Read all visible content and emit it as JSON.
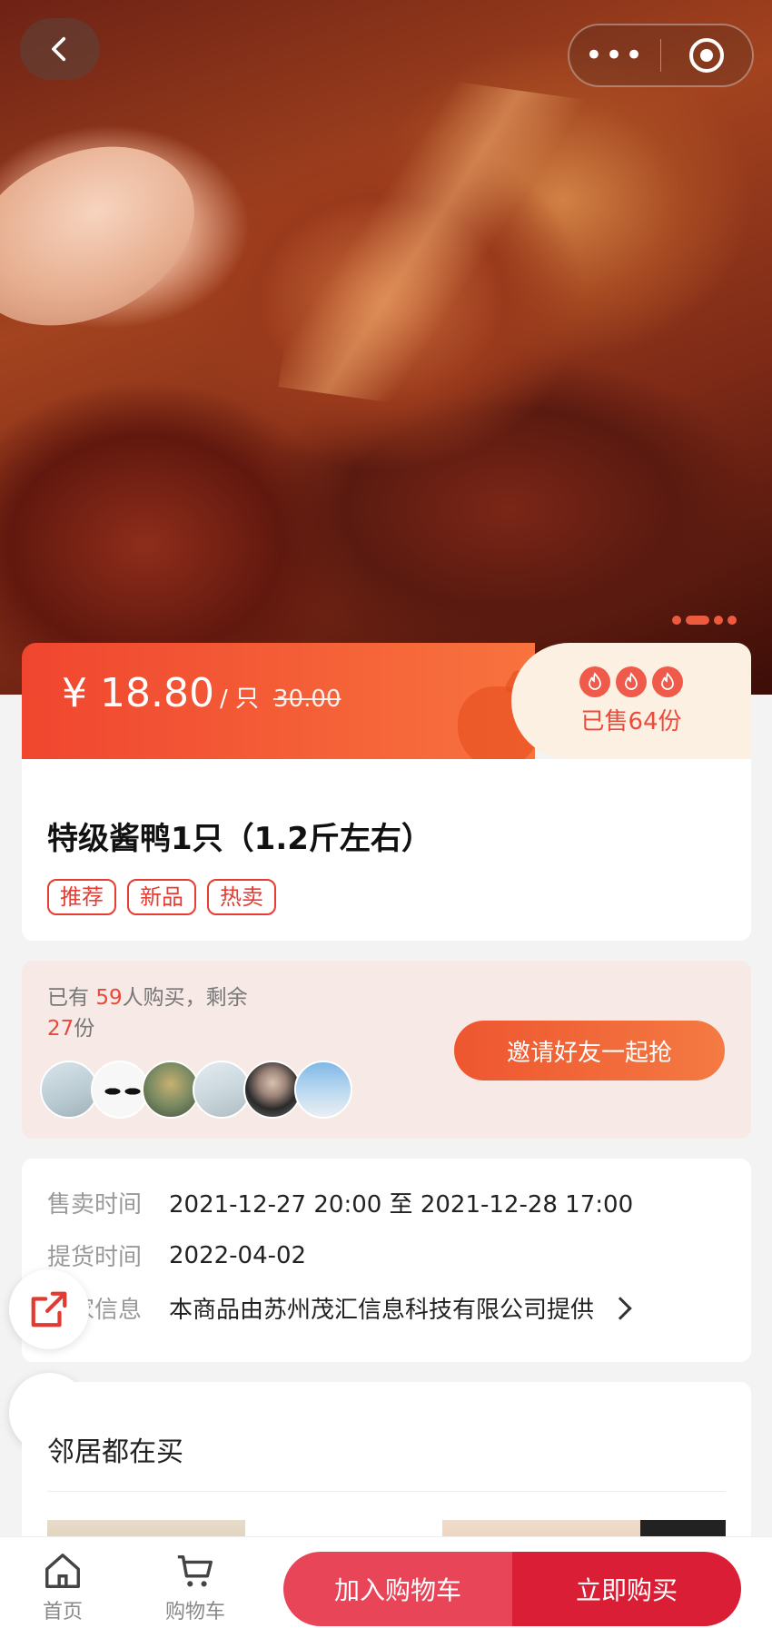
{
  "nav": {
    "back_icon": "chevron-left-icon",
    "more_icon": "more-dots-icon",
    "close_icon": "target-circle-icon"
  },
  "hero": {
    "image_count": 4,
    "active_index": 1
  },
  "price": {
    "amount": "¥ 18.80",
    "unit": "/ 只",
    "original": "30.00",
    "sold": "已售64份",
    "accent_color": "#f0462f"
  },
  "product": {
    "title": "特级酱鸭1只（1.2斤左右）",
    "tags": [
      "推荐",
      "新品",
      "热卖"
    ]
  },
  "group_buy": {
    "prefix": "已有 ",
    "count": "59",
    "middle": "人购买，剩余",
    "remaining": "27",
    "suffix": "份",
    "invite_label": "邀请好友一起抢"
  },
  "info": {
    "sale_time_label": "售卖时间",
    "sale_time_value": "2021-12-27 20:00 至 2021-12-28 17:00",
    "pickup_label": "提货时间",
    "pickup_value": "2022-04-02",
    "merchant_label": "商家信息",
    "merchant_value": "本商品由苏州茂汇信息科技有限公司提供"
  },
  "neighbors": {
    "title": "邻居都在买"
  },
  "bottom": {
    "home_label": "首页",
    "cart_tab_label": "购物车",
    "add_cart_label": "加入购物车",
    "buy_label": "立即购买"
  },
  "colors": {
    "primary_red": "#d91e35",
    "cart_red": "#e84559",
    "orange": "#f47a42"
  }
}
